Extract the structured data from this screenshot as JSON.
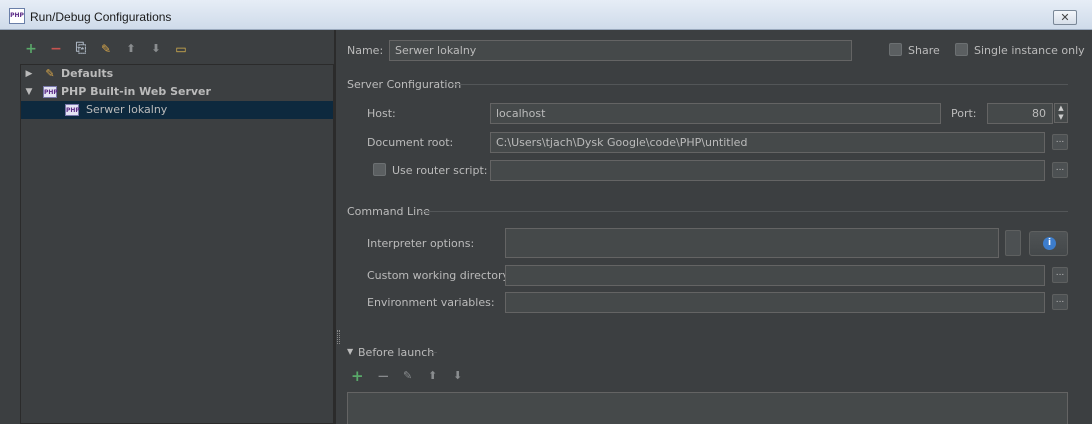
{
  "window": {
    "title": "Run/Debug Configurations",
    "app_icon_text": "PHP",
    "close_glyph": "✕"
  },
  "toolbar": {
    "add_glyph": "+",
    "remove_glyph": "−",
    "copy_glyph": "⎘",
    "edit_defaults_glyph": "✎",
    "move_up_glyph": "⬆",
    "move_down_glyph": "⬇",
    "folder_glyph": "▭"
  },
  "tree": {
    "items": [
      {
        "label": "Defaults",
        "arrow": "▶",
        "icon": "wrench-icon"
      },
      {
        "label": "PHP Built-in Web Server",
        "arrow": "▼",
        "icon": "php-icon",
        "icon_text": "PHP"
      },
      {
        "label": "Serwer lokalny",
        "icon": "php-icon",
        "icon_text": "PHP",
        "selected": true
      }
    ]
  },
  "form": {
    "name_label": "Name:",
    "name_value": "Serwer lokalny",
    "share_label": "Share",
    "single_instance_label": "Single instance only",
    "server_config_title": "Server Configuration",
    "host_label": "Host:",
    "host_value": "localhost",
    "port_label": "Port:",
    "port_value": "80",
    "docroot_label": "Document root:",
    "docroot_value": "C:\\Users\\tjach\\Dysk Google\\code\\PHP\\untitled",
    "router_label": "Use router script:",
    "router_value": "",
    "command_line_title": "Command Line",
    "interpreter_label": "Interpreter options:",
    "interpreter_value": "",
    "workdir_label": "Custom working directory:",
    "workdir_value": "",
    "env_label": "Environment variables:",
    "env_value": "",
    "ellipsis_glyph": "...",
    "info_glyph": "i",
    "spinner_up": "▲",
    "spinner_down": "▼"
  },
  "before_launch": {
    "title": "Before launch",
    "arrow": "▼",
    "add_glyph": "+",
    "remove_glyph": "−",
    "edit_glyph": "✎",
    "up_glyph": "⬆",
    "down_glyph": "⬇"
  },
  "colors": {
    "background": "#3c3f41",
    "field": "#45494a",
    "selection": "#0d293e",
    "add_green": "#59a869",
    "remove_red": "#c75450",
    "accent_blue": "#3d7dcc"
  }
}
